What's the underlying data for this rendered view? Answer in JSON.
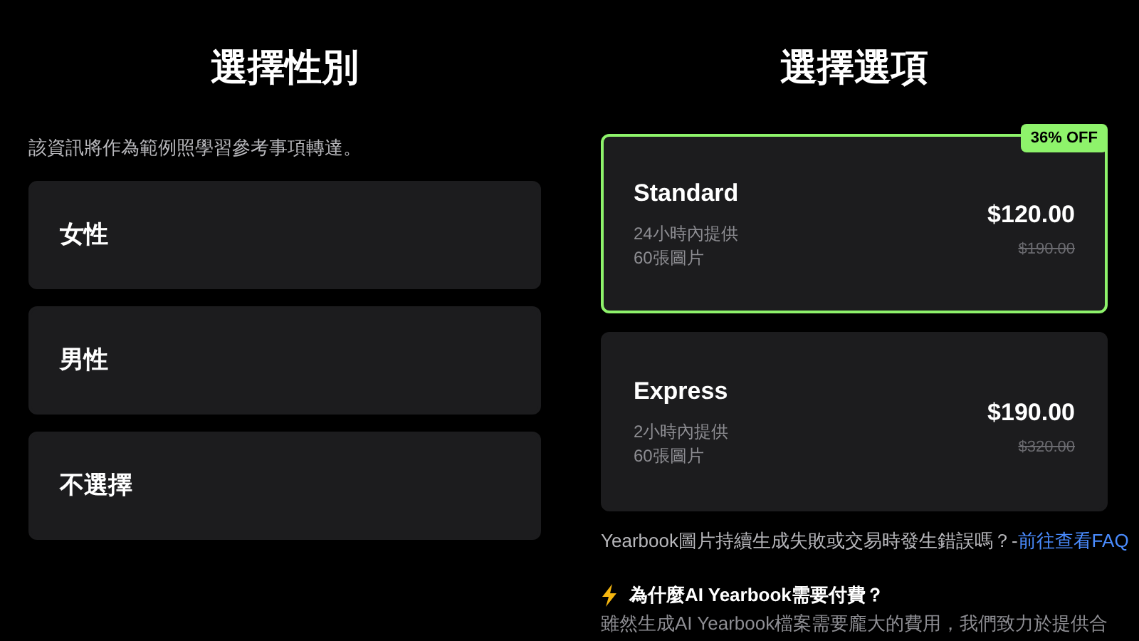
{
  "gender": {
    "title": "選擇性別",
    "note": "該資訊將作為範例照學習參考事項轉達。",
    "options": [
      {
        "label": "女性",
        "selected": false
      },
      {
        "label": "男性",
        "selected": false
      },
      {
        "label": "不選擇",
        "selected": false
      }
    ]
  },
  "plans": {
    "title": "選擇選項",
    "items": [
      {
        "name": "Standard",
        "lines": [
          "24小時內提供",
          "60張圖片"
        ],
        "price": "$120.00",
        "old_price": "$190.00",
        "badge": "36% OFF",
        "selected": true
      },
      {
        "name": "Express",
        "lines": [
          "2小時內提供",
          "60張圖片"
        ],
        "price": "$190.00",
        "old_price": "$320.00",
        "selected": false
      }
    ],
    "help": "Yearbook圖片持續生成失敗或交易時發生錯誤嗎？-",
    "help_link": "前往查看FAQ",
    "why_title": "為什麼AI Yearbook需要付費？",
    "why_text": "雖然生成AI Yearbook檔案需要龐大的費用，我們致力於提供合"
  }
}
